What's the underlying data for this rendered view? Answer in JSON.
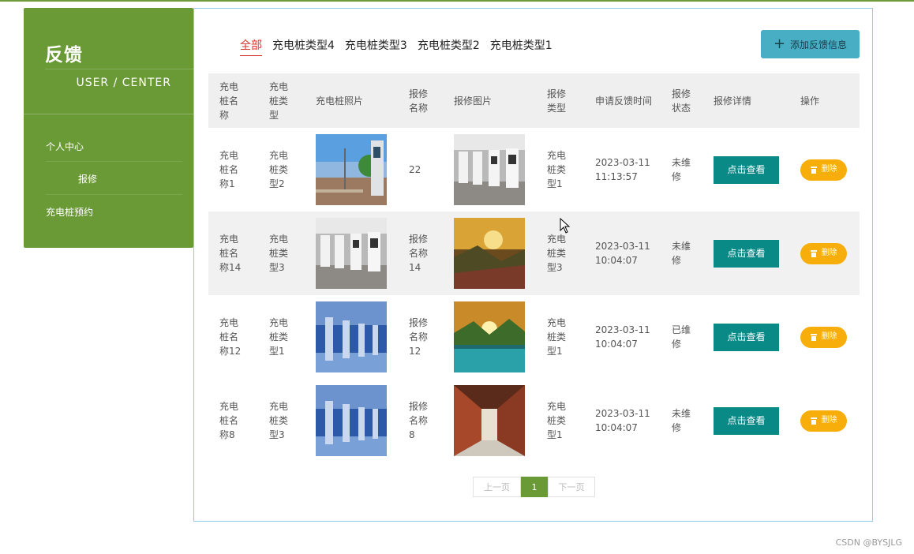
{
  "colors": {
    "sidebar": "#6a9a36",
    "view_button": "#0a8a87",
    "delete_button": "#f7ae0a",
    "add_button": "#47aec4",
    "active_tab": "#d9352a"
  },
  "sidebar": {
    "title": "反馈",
    "subtitle": "USER / CENTER",
    "items": [
      {
        "label": "个人中心"
      },
      {
        "label": "报修"
      },
      {
        "label": "充电桩预约"
      }
    ]
  },
  "tabs": [
    "全部",
    "充电桩类型4",
    "充电桩类型3",
    "充电桩类型2",
    "充电桩类型1"
  ],
  "add_button": {
    "icon": "plus-icon",
    "label": "添加反馈信息"
  },
  "table": {
    "headers": [
      "充电桩名称",
      "充电桩类型",
      "充电桩照片",
      "报修名称",
      "报修图片",
      "报修类型",
      "申请反馈时间",
      "报修状态",
      "报修详情",
      "操作"
    ],
    "rows": [
      {
        "name": "充电桩名称1",
        "type": "充电桩类型2",
        "photo": "charging-station-outdoor-image",
        "repair_name": "22",
        "repair_image": "charging-station-row-image",
        "repair_type": "充电桩类型1",
        "time": "2023-03-11 11:13:57",
        "status": "未维修",
        "detail": "点击查看",
        "action": "删除"
      },
      {
        "name": "充电桩名称14",
        "type": "充电桩类型3",
        "photo": "charging-station-row-image",
        "repair_name": "报修名称14",
        "repair_image": "mountain-sunset-image",
        "repair_type": "充电桩类型3",
        "time": "2023-03-11 10:04:07",
        "status": "未维修",
        "detail": "点击查看",
        "action": "删除"
      },
      {
        "name": "充电桩名称12",
        "type": "充电桩类型1",
        "photo": "blue-chargers-image",
        "repair_name": "报修名称12",
        "repair_image": "lake-sunset-image",
        "repair_type": "充电桩类型1",
        "time": "2023-03-11 10:04:07",
        "status": "已维修",
        "detail": "点击查看",
        "action": "删除"
      },
      {
        "name": "充电桩名称8",
        "type": "充电桩类型3",
        "photo": "blue-chargers-image",
        "repair_name": "报修名称8",
        "repair_image": "corridor-image",
        "repair_type": "充电桩类型1",
        "time": "2023-03-11 10:04:07",
        "status": "未维修",
        "detail": "点击查看",
        "action": "删除"
      }
    ]
  },
  "pagination": {
    "prev": "上一页",
    "current": "1",
    "next": "下一页"
  },
  "watermark": "CSDN @BYSJLG"
}
